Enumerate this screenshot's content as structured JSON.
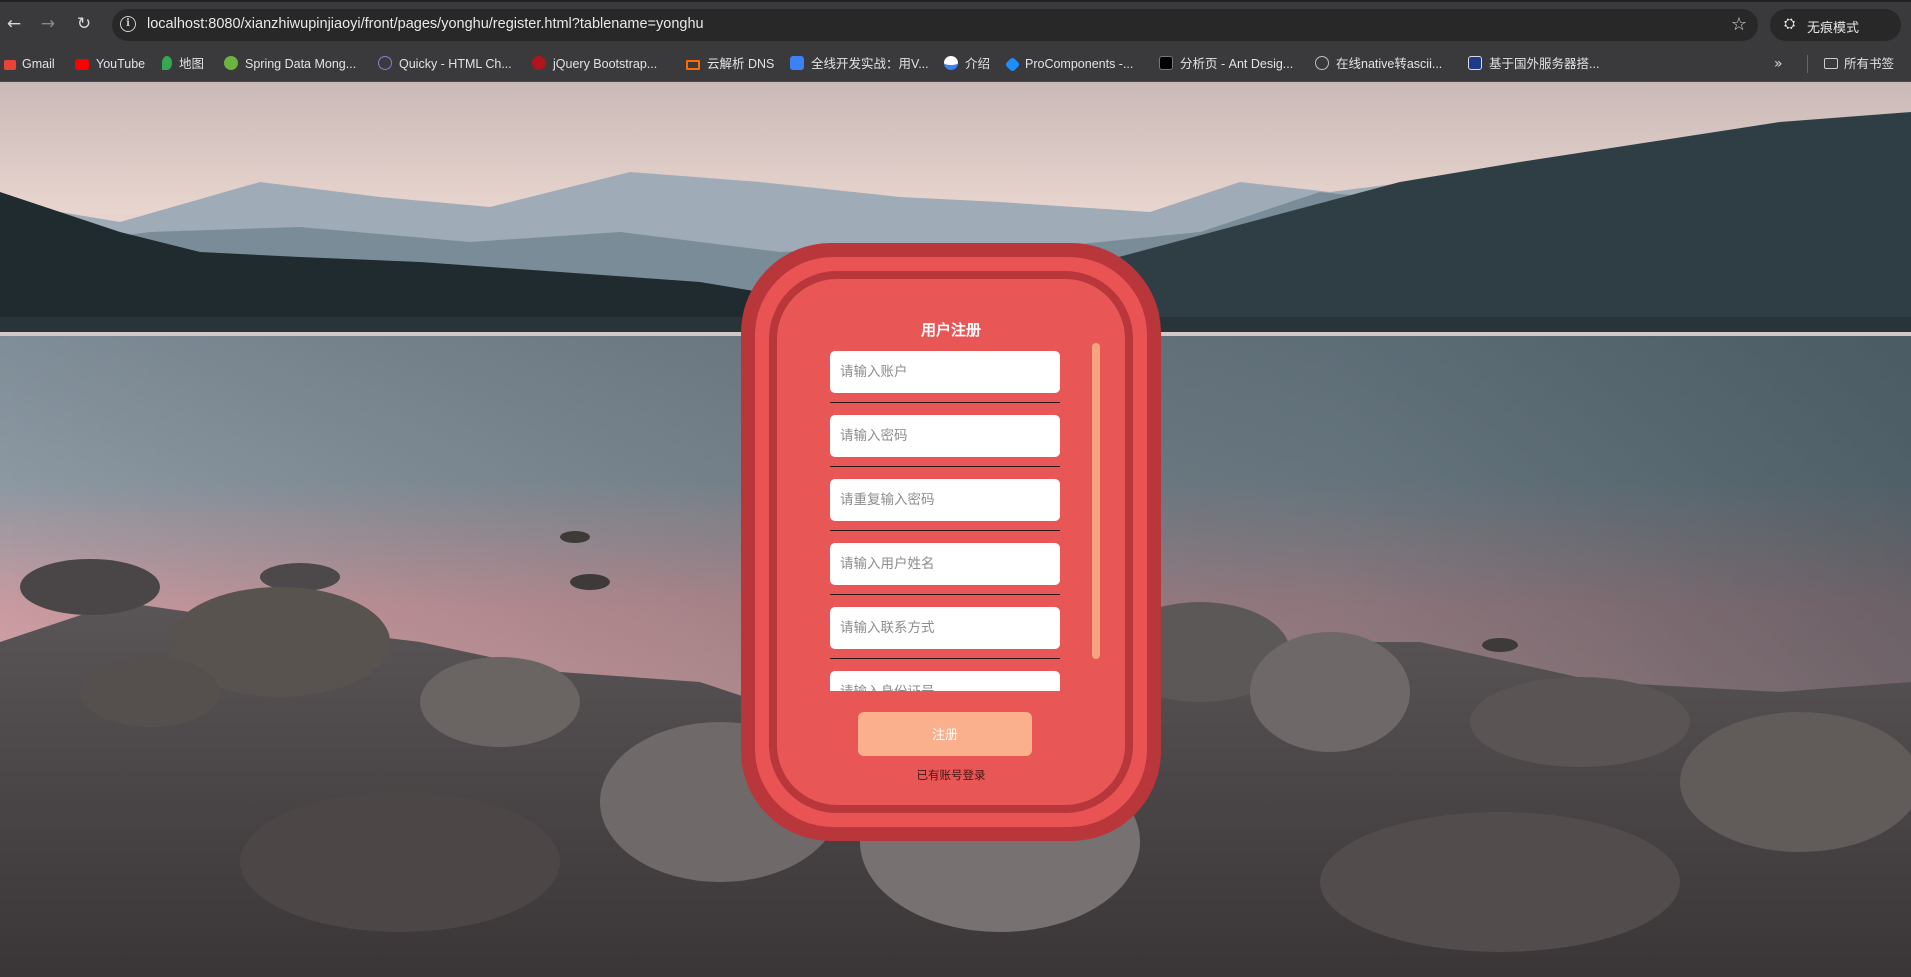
{
  "browser": {
    "url": "localhost:8080/xianzhiwupinjiaoyi/front/pages/yonghu/register.html?tablename=yonghu",
    "incognito_label": "无痕模式",
    "back_icon": "←",
    "forward_icon": "→",
    "reload_icon": "↻",
    "star_icon": "☆",
    "info_icon": "i",
    "incognito_icon": "⛭",
    "bookmarks": [
      {
        "label": "Gmail",
        "color": "#ea4335"
      },
      {
        "label": "YouTube",
        "color": "#ff0000"
      },
      {
        "label": "地图",
        "color": "#34a853"
      },
      {
        "label": "Spring Data Mong...",
        "color": "#6db33f"
      },
      {
        "label": "Quicky - HTML Ch...",
        "color": "#6a5acd"
      },
      {
        "label": "jQuery Bootstrap...",
        "color": "#c0392b"
      },
      {
        "label": "云解析 DNS",
        "color": "#ff6a00"
      },
      {
        "label": "全线开发实战：用V...",
        "color": "#3b82f6"
      },
      {
        "label": "介绍",
        "color": "#ffffff"
      },
      {
        "label": "ProComponents -...",
        "color": "#1890ff"
      },
      {
        "label": "分析页 - Ant Desig...",
        "color": "#000000"
      },
      {
        "label": "在线native转ascii...",
        "color": "#bdbdbd"
      },
      {
        "label": "基于国外服务器搭...",
        "color": "#1e3a8a"
      }
    ],
    "more_icon": "»",
    "all_bookmarks_label": "所有书签"
  },
  "form": {
    "title": "用户注册",
    "fields": [
      {
        "placeholder": "请输入账户",
        "value": ""
      },
      {
        "placeholder": "请输入密码",
        "value": ""
      },
      {
        "placeholder": "请重复输入密码",
        "value": ""
      },
      {
        "placeholder": "请输入用户姓名",
        "value": ""
      },
      {
        "placeholder": "请输入联系方式",
        "value": ""
      },
      {
        "placeholder": "请输入身份证号",
        "value": ""
      }
    ],
    "submit_label": "注册",
    "login_link": "已有账号登录"
  },
  "colors": {
    "card_border": "#b9363b",
    "card_fill": "#e95353",
    "button": "#fbb08d",
    "scrollbar": "#f4a57f"
  }
}
